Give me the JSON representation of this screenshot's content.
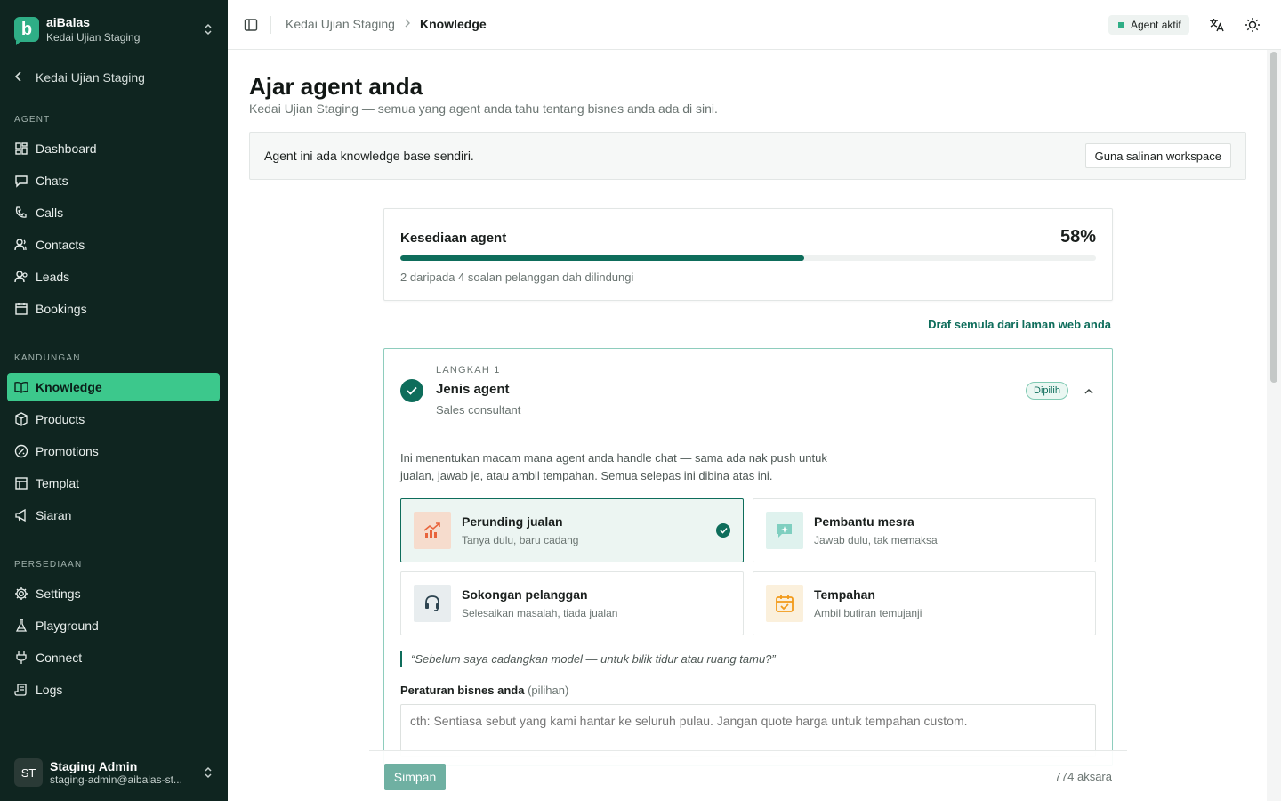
{
  "workspace": {
    "name": "aiBalas",
    "store": "Kedai Ujian Staging"
  },
  "back_link": "Kedai Ujian Staging",
  "sidebar": {
    "sections": [
      {
        "label": "AGENT",
        "items": [
          "Dashboard",
          "Chats",
          "Calls",
          "Contacts",
          "Leads",
          "Bookings"
        ]
      },
      {
        "label": "KANDUNGAN",
        "items": [
          "Knowledge",
          "Products",
          "Promotions",
          "Templat",
          "Siaran"
        ]
      },
      {
        "label": "PERSEDIAAN",
        "items": [
          "Settings",
          "Playground",
          "Connect",
          "Logs"
        ]
      }
    ],
    "active_item": "Knowledge"
  },
  "user": {
    "initials": "ST",
    "name": "Staging Admin",
    "email": "staging-admin@aibalas-st..."
  },
  "topbar": {
    "breadcrumb": [
      "Kedai Ujian Staging",
      "Knowledge"
    ],
    "status": "Agent aktif"
  },
  "page": {
    "title": "Ajar agent anda",
    "subtitle": "Kedai Ujian Staging — semua yang agent anda tahu tentang bisnes anda ada di sini."
  },
  "kb_banner": {
    "text": "Agent ini ada knowledge base sendiri.",
    "button": "Guna salinan workspace"
  },
  "readiness": {
    "label": "Kesediaan agent",
    "percent_text": "58%",
    "progress": 0.58,
    "note": "2 daripada 4 soalan pelanggan dah dilindungi"
  },
  "draft_link": "Draf semula dari laman web anda",
  "step": {
    "number_label": "LANGKAH 1",
    "title": "Jenis agent",
    "value": "Sales consultant",
    "badge": "Dipilih",
    "description": "Ini menentukan macam mana agent anda handle chat — sama ada nak push untuk jualan, jawab je, atau ambil tempahan. Semua selepas ini dibina atas ini.",
    "options": [
      {
        "title": "Perunding jualan",
        "subtitle": "Tanya dulu, baru cadang",
        "icon": "chart-up-icon",
        "selected": true
      },
      {
        "title": "Pembantu mesra",
        "subtitle": "Jawab dulu, tak memaksa",
        "icon": "chat-sparkle-icon",
        "selected": false
      },
      {
        "title": "Sokongan pelanggan",
        "subtitle": "Selesaikan masalah, tiada jualan",
        "icon": "headset-icon",
        "selected": false
      },
      {
        "title": "Tempahan",
        "subtitle": "Ambil butiran temujanji",
        "icon": "calendar-check-icon",
        "selected": false
      }
    ],
    "quote": "“Sebelum saya cadangkan model — untuk bilik tidur atau ruang tamu?”",
    "rules_label": "Peraturan bisnes anda",
    "rules_optional": "(pilihan)",
    "rules_placeholder": "cth: Sentiasa sebut yang kami hantar ke seluruh pulau. Jangan quote harga untuk tempahan custom."
  },
  "footer": {
    "save": "Simpan",
    "char_count": "774 aksara"
  },
  "colors": {
    "sidebar_bg": "#0f2520",
    "active_nav": "#3cc88c",
    "brand": "#0e6d5b",
    "status_dot": "#2fae86"
  }
}
